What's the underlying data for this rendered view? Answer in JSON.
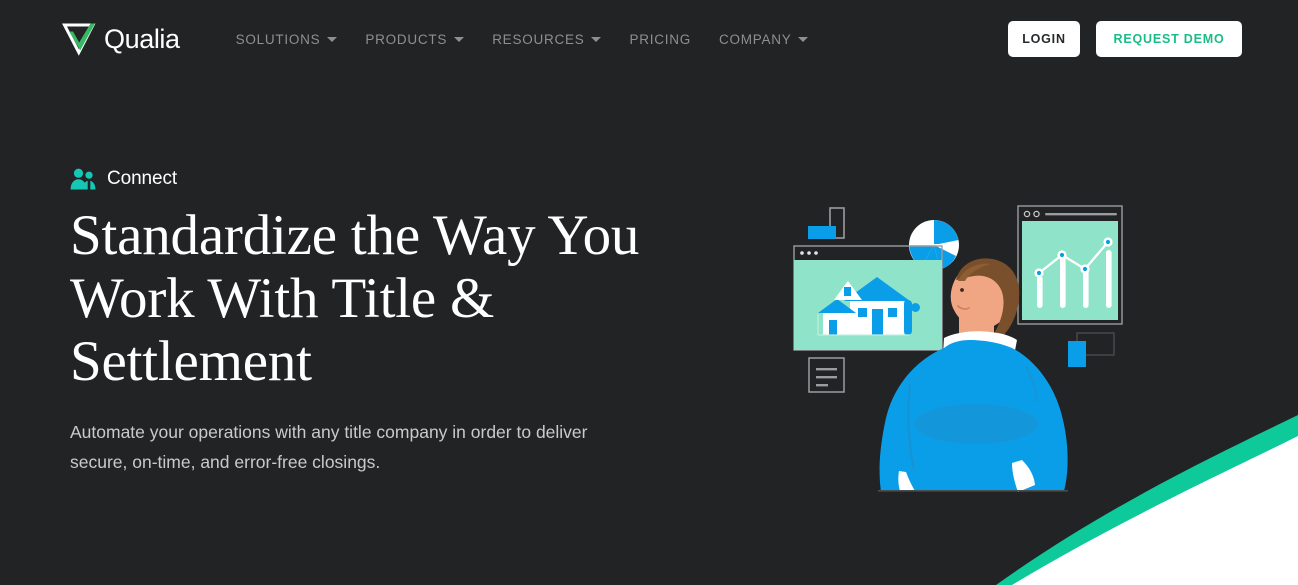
{
  "palette": {
    "background_dark": "#222325",
    "accent_green": "#0ec99a",
    "brand_green": "#36b864",
    "cta_green": "#1bbd85",
    "teal_icon": "#14c8b5",
    "panel_mint": "#8fe3c9",
    "illustration_blue": "#0b9ee8",
    "hair_brown": "#7a4f2c",
    "skin": "#f0a583",
    "nav_text": "#8d8f90",
    "body_text": "#c9cacb",
    "white": "#ffffff"
  },
  "header": {
    "brand": {
      "name": "Qualia",
      "mark_icon": "qualia-triangle-check-logo"
    },
    "nav": [
      {
        "label": "SOLUTIONS",
        "has_dropdown": true,
        "icon": "chevron-down-icon"
      },
      {
        "label": "PRODUCTS",
        "has_dropdown": true,
        "icon": "chevron-down-icon"
      },
      {
        "label": "RESOURCES",
        "has_dropdown": true,
        "icon": "chevron-down-icon"
      },
      {
        "label": "PRICING",
        "has_dropdown": false,
        "icon": ""
      },
      {
        "label": "COMPANY",
        "has_dropdown": true,
        "icon": "chevron-down-icon"
      }
    ],
    "login_label": "LOGIN",
    "request_demo_label": "REQUEST DEMO"
  },
  "hero": {
    "eyebrow": {
      "label": "Connect",
      "icon": "users-group-icon"
    },
    "title": "Standardize the Way You Work With Title & Settlement",
    "subtitle": "Automate your operations with any title company in order to deliver secure, on-time, and error-free closings."
  },
  "illustration": {
    "name": "professional-viewing-dashboards-illustration",
    "elements": [
      "house-property-window",
      "analytics-chart-window",
      "pie-chart",
      "person-back-view",
      "document-lines-icon",
      "blue-rectangle-accent-top",
      "blue-rectangle-accent-right"
    ]
  }
}
